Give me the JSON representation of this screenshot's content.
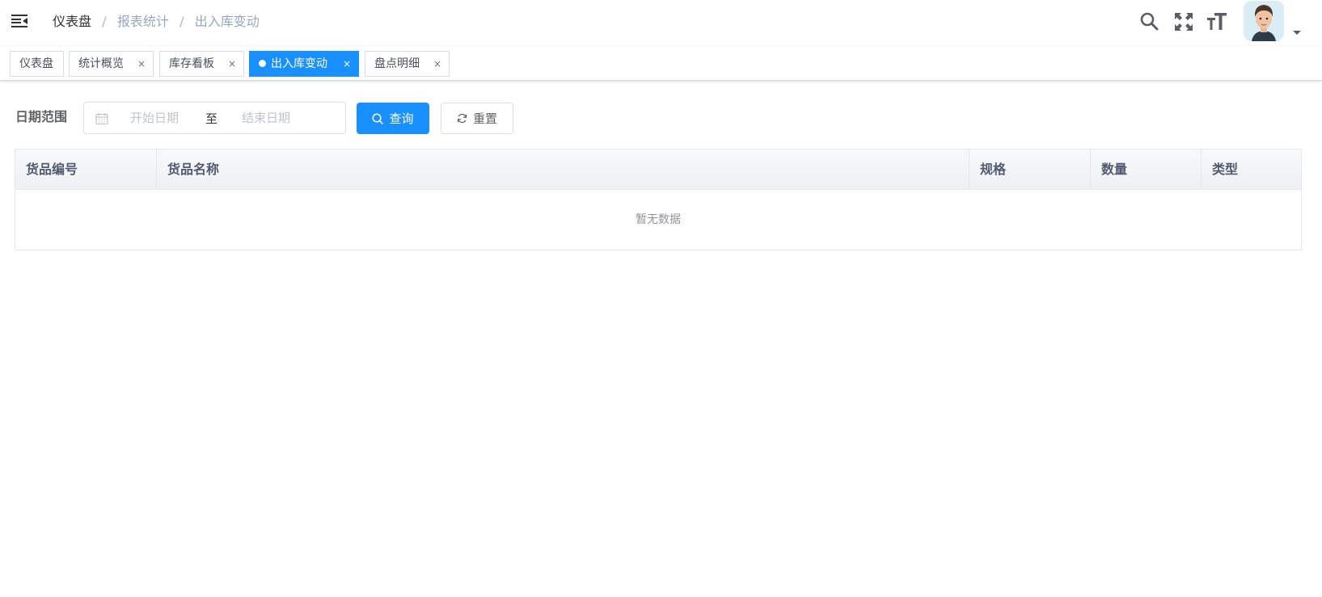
{
  "breadcrumb": [
    "仪表盘",
    "报表统计",
    "出入库变动"
  ],
  "breadcrumb_separator": "/",
  "header_icons": [
    "search-icon",
    "fullscreen-icon",
    "font-size-icon"
  ],
  "tags": [
    {
      "label": "仪表盘",
      "closable": false,
      "active": false
    },
    {
      "label": "统计概览",
      "closable": true,
      "active": false
    },
    {
      "label": "库存看板",
      "closable": true,
      "active": false
    },
    {
      "label": "出入库变动",
      "closable": true,
      "active": true
    },
    {
      "label": "盘点明细",
      "closable": true,
      "active": false
    }
  ],
  "tag_close": "×",
  "filter": {
    "label": "日期范围",
    "start_placeholder": "开始日期",
    "range_separator": "至",
    "end_placeholder": "结束日期",
    "search_label": "查询",
    "reset_label": "重置"
  },
  "table": {
    "columns": [
      "货品编号",
      "货品名称",
      "规格",
      "数量",
      "类型"
    ],
    "rows": [],
    "empty_text": "暂无数据"
  },
  "colors": {
    "accent": "#1890ff",
    "border": "#dcdfe6",
    "text": "#303133"
  }
}
